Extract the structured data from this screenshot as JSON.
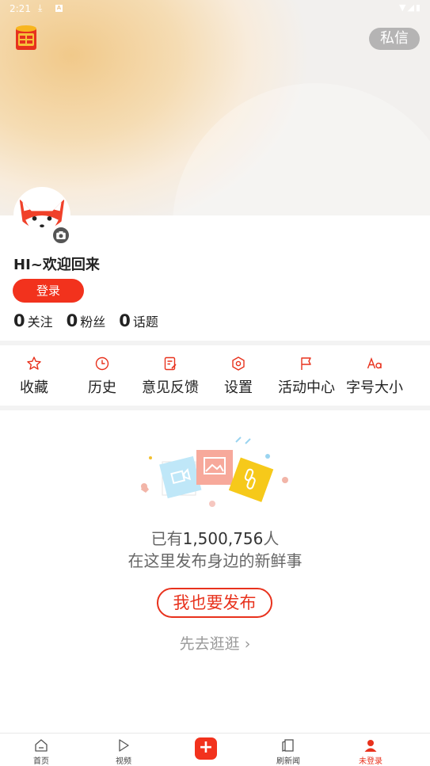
{
  "status_bar": {
    "time": "2:21"
  },
  "header": {
    "message_button": "私信"
  },
  "profile": {
    "welcome": "HI~欢迎回来",
    "login_button": "登录",
    "stats": [
      {
        "count": "0",
        "label": "关注"
      },
      {
        "count": "0",
        "label": "粉丝"
      },
      {
        "count": "0",
        "label": "话题"
      }
    ]
  },
  "menu": [
    {
      "label": "收藏",
      "icon": "star-icon"
    },
    {
      "label": "历史",
      "icon": "clock-icon"
    },
    {
      "label": "意见反馈",
      "icon": "feedback-icon"
    },
    {
      "label": "设置",
      "icon": "settings-icon"
    },
    {
      "label": "活动中心",
      "icon": "flag-icon"
    },
    {
      "label": "字号大小",
      "icon": "font-size-icon"
    }
  ],
  "empty_state": {
    "count_prefix": "已有",
    "count": "1,500,756",
    "count_suffix": "人",
    "description": "在这里发布身边的新鲜事",
    "publish_button": "我也要发布",
    "browse_link": "先去逛逛 ›"
  },
  "tabbar": [
    {
      "label": "首页",
      "icon": "home-icon"
    },
    {
      "label": "视频",
      "icon": "play-icon"
    },
    {
      "label": "",
      "icon": "plus-icon"
    },
    {
      "label": "刷新闻",
      "icon": "news-icon"
    },
    {
      "label": "未登录",
      "icon": "user-icon",
      "active": true
    }
  ],
  "colors": {
    "accent": "#f2321d",
    "text": "#222222",
    "muted": "#999999"
  }
}
